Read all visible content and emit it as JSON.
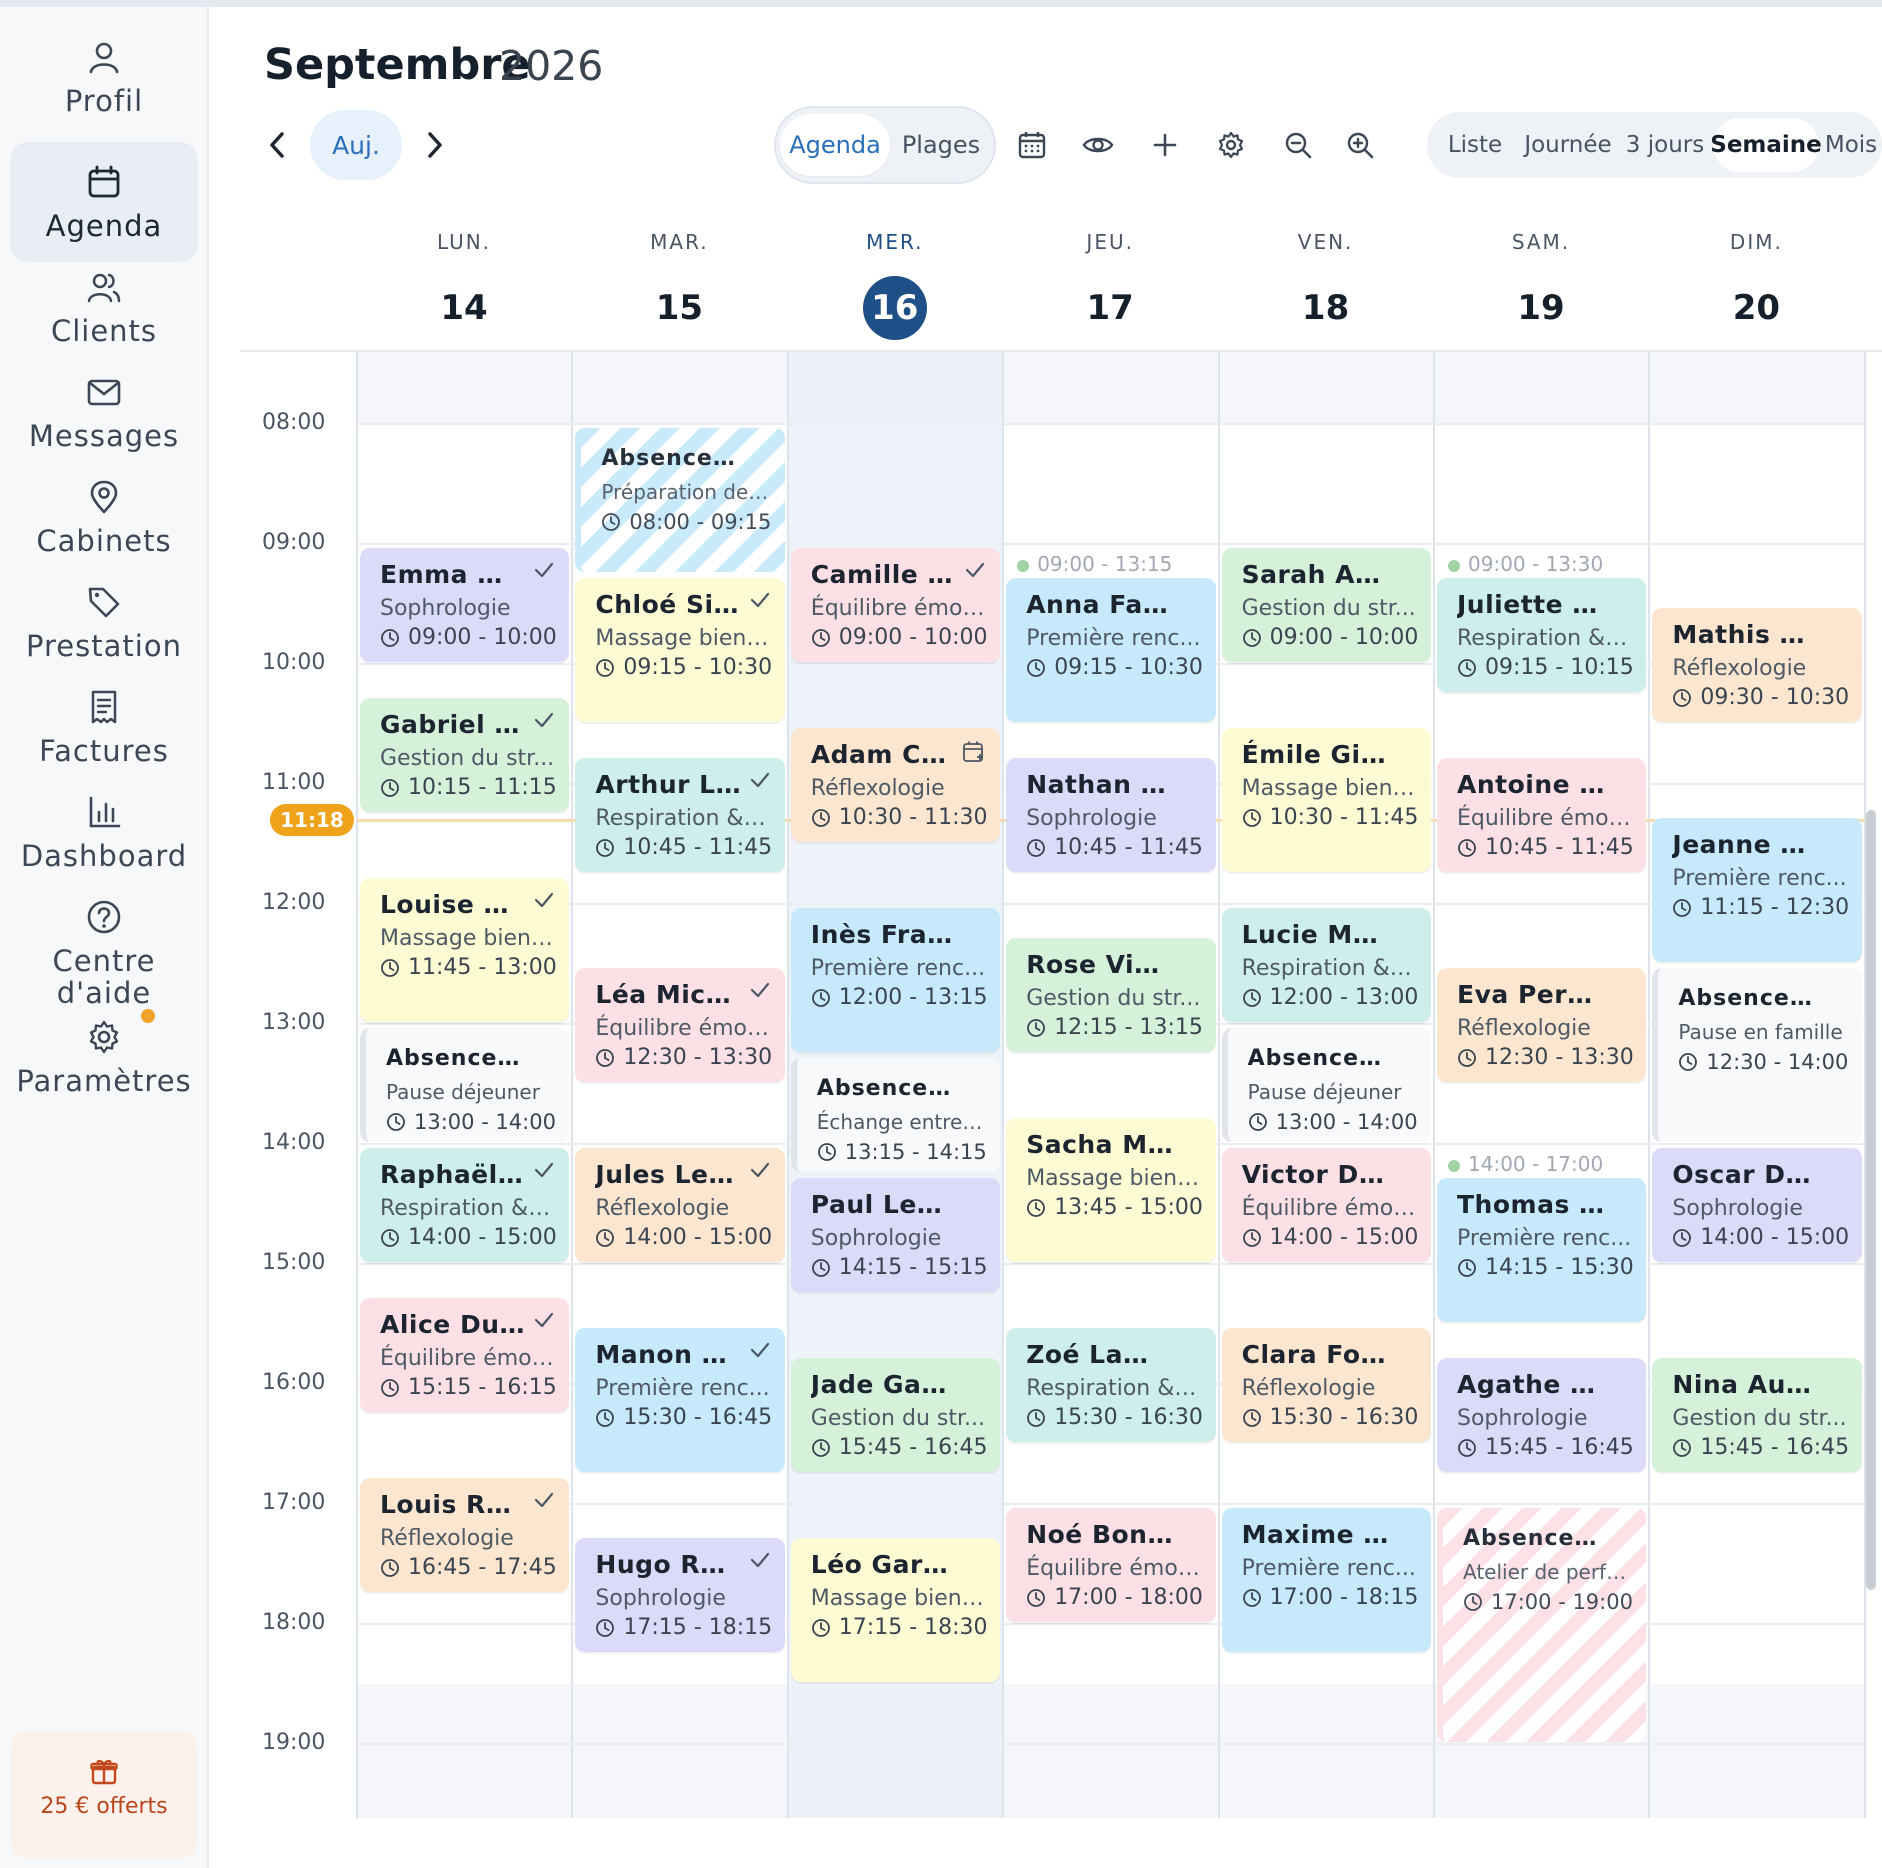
{
  "sidebar": {
    "items": [
      {
        "label": "Profil",
        "icon": "user-icon"
      },
      {
        "label": "Agenda",
        "icon": "calendar-icon",
        "active": true
      },
      {
        "label": "Clients",
        "icon": "users-icon"
      },
      {
        "label": "Messages",
        "icon": "mail-icon"
      },
      {
        "label": "Cabinets",
        "icon": "map-pin-icon"
      },
      {
        "label": "Prestation",
        "icon": "tag-icon"
      },
      {
        "label": "Factures",
        "icon": "receipt-icon"
      },
      {
        "label": "Dashboard",
        "icon": "bar-chart-icon"
      },
      {
        "label": "Centre d'aide",
        "icon": "help-circle-icon"
      },
      {
        "label": "Paramètres",
        "icon": "gear-icon",
        "notification": true
      }
    ],
    "promo": {
      "label": "25 € offerts",
      "icon": "gift-icon"
    }
  },
  "header": {
    "month": "Septembre",
    "year": "2026",
    "today_label": "Auj.",
    "modes": [
      "Agenda",
      "Plages"
    ],
    "active_mode": "Agenda",
    "views": [
      "Liste",
      "Journée",
      "3 jours",
      "Semaine",
      "Mois"
    ],
    "active_view": "Semaine"
  },
  "days": [
    {
      "name": "LUN.",
      "num": "14"
    },
    {
      "name": "MAR.",
      "num": "15"
    },
    {
      "name": "MER.",
      "num": "16",
      "today": true
    },
    {
      "name": "JEU.",
      "num": "17"
    },
    {
      "name": "VEN.",
      "num": "18"
    },
    {
      "name": "SAM.",
      "num": "19"
    },
    {
      "name": "DIM.",
      "num": "20"
    }
  ],
  "hours": [
    "08:00",
    "09:00",
    "10:00",
    "11:00",
    "12:00",
    "13:00",
    "14:00",
    "15:00",
    "16:00",
    "17:00",
    "18:00",
    "19:00"
  ],
  "now": "11:18",
  "colors": {
    "violet": "#dcdaf9",
    "green": "#d5f1d9",
    "yellow": "#fdfbd3",
    "teal": "#cdeeea",
    "pink": "#fde0e6",
    "peach": "#fde6cf",
    "blue": "#c6e9fb",
    "absence": "#f8f9fb",
    "today_column": "#eef3fa",
    "accent": "#1e4f86",
    "now": "#efa21a"
  },
  "slots": [
    {
      "day": 3,
      "range": "09:00 - 13:15"
    },
    {
      "day": 5,
      "range": "09:00 - 13:30"
    },
    {
      "day": 5,
      "range": "14:00 - 17:00"
    }
  ],
  "events": [
    {
      "day": 0,
      "title": "Emma Mo...",
      "sub": "Sophrologie",
      "time": "09:00 - 10:00",
      "color": "violet",
      "check": true
    },
    {
      "day": 0,
      "title": "Gabriel Pe...",
      "sub": "Gestion du str...",
      "time": "10:15 - 11:15",
      "color": "green",
      "check": true
    },
    {
      "day": 0,
      "title": "Louise Ma...",
      "sub": "Massage bien-...",
      "time": "11:45 - 13:00",
      "color": "yellow",
      "check": true
    },
    {
      "day": 0,
      "title": "Absence · Per...",
      "sub": "Pause déjeuner",
      "time": "13:00 - 14:00",
      "color": "absence",
      "absence": true
    },
    {
      "day": 0,
      "title": "Raphaël B...",
      "sub": "Respiration & ...",
      "time": "14:00 - 15:00",
      "color": "teal",
      "check": true
    },
    {
      "day": 0,
      "title": "Alice Dub...",
      "sub": "Équilibre émot...",
      "time": "15:15 - 16:15",
      "color": "pink",
      "check": true
    },
    {
      "day": 0,
      "title": "Louis Rob...",
      "sub": "Réflexologie",
      "time": "16:45 - 17:45",
      "color": "peach",
      "check": true
    },
    {
      "day": 1,
      "title": "Absence · Aut...",
      "sub": "Préparation des ...",
      "time": "08:00 - 09:15",
      "color": "blue",
      "absence": true,
      "striped": true
    },
    {
      "day": 1,
      "title": "Chloé Sim...",
      "sub": "Massage bien-...",
      "time": "09:15 - 10:30",
      "color": "yellow",
      "check": true
    },
    {
      "day": 1,
      "title": "Arthur La...",
      "sub": "Respiration & ...",
      "time": "10:45 - 11:45",
      "color": "teal",
      "check": true
    },
    {
      "day": 1,
      "title": "Léa Michel",
      "sub": "Équilibre émot...",
      "time": "12:30 - 13:30",
      "color": "pink",
      "check": true
    },
    {
      "day": 1,
      "title": "Jules Lefè...",
      "sub": "Réflexologie",
      "time": "14:00 - 15:00",
      "color": "peach",
      "check": true
    },
    {
      "day": 1,
      "title": "Manon Le...",
      "sub": "Première renc...",
      "time": "15:30 - 16:45",
      "color": "blue",
      "check": true
    },
    {
      "day": 1,
      "title": "Hugo Roux",
      "sub": "Sophrologie",
      "time": "17:15 - 18:15",
      "color": "violet",
      "check": true
    },
    {
      "day": 2,
      "title": "Camille F...",
      "sub": "Équilibre émot...",
      "time": "09:00 - 10:00",
      "color": "pink",
      "check": true
    },
    {
      "day": 2,
      "title": "Adam Che...",
      "sub": "Réflexologie",
      "time": "10:30 - 11:30",
      "color": "peach",
      "calendar": true
    },
    {
      "day": 2,
      "title": "Inès François",
      "sub": "Première renc...",
      "time": "12:00 - 13:15",
      "color": "blue"
    },
    {
      "day": 2,
      "title": "Absence · Aut...",
      "sub": "Échange entre p...",
      "time": "13:15 - 14:15",
      "color": "absence",
      "absence": true
    },
    {
      "day": 2,
      "title": "Paul Legrand",
      "sub": "Sophrologie",
      "time": "14:15 - 15:15",
      "color": "violet"
    },
    {
      "day": 2,
      "title": "Jade Gauthier",
      "sub": "Gestion du str...",
      "time": "15:45 - 16:45",
      "color": "green"
    },
    {
      "day": 2,
      "title": "Léo Garnier",
      "sub": "Massage bien-...",
      "time": "17:15 - 18:30",
      "color": "yellow"
    },
    {
      "day": 3,
      "title": "Anna Faure",
      "sub": "Première renc...",
      "time": "09:15 - 10:30",
      "color": "blue"
    },
    {
      "day": 3,
      "title": "Nathan Rous...",
      "sub": "Sophrologie",
      "time": "10:45 - 11:45",
      "color": "violet"
    },
    {
      "day": 3,
      "title": "Rose Vincent",
      "sub": "Gestion du str...",
      "time": "12:15 - 13:15",
      "color": "green"
    },
    {
      "day": 3,
      "title": "Sacha Muller",
      "sub": "Massage bien-...",
      "time": "13:45 - 15:00",
      "color": "yellow"
    },
    {
      "day": 3,
      "title": "Zoé Lambert",
      "sub": "Respiration & ...",
      "time": "15:30 - 16:30",
      "color": "teal"
    },
    {
      "day": 3,
      "title": "Noé Bonnet",
      "sub": "Équilibre émot...",
      "time": "17:00 - 18:00",
      "color": "pink"
    },
    {
      "day": 4,
      "title": "Sarah André",
      "sub": "Gestion du str...",
      "time": "09:00 - 10:00",
      "color": "green"
    },
    {
      "day": 4,
      "title": "Émile Girard",
      "sub": "Massage bien-...",
      "time": "10:30 - 11:45",
      "color": "yellow"
    },
    {
      "day": 4,
      "title": "Lucie Mercier",
      "sub": "Respiration & ...",
      "time": "12:00 - 13:00",
      "color": "teal"
    },
    {
      "day": 4,
      "title": "Absence · Per...",
      "sub": "Pause déjeuner",
      "time": "13:00 - 14:00",
      "color": "absence",
      "absence": true
    },
    {
      "day": 4,
      "title": "Victor Dupont",
      "sub": "Équilibre émot...",
      "time": "14:00 - 15:00",
      "color": "pink"
    },
    {
      "day": 4,
      "title": "Clara Fournier",
      "sub": "Réflexologie",
      "time": "15:30 - 16:30",
      "color": "peach"
    },
    {
      "day": 4,
      "title": "Maxime Robin",
      "sub": "Première renc...",
      "time": "17:00 - 18:15",
      "color": "blue"
    },
    {
      "day": 5,
      "title": "Juliette Mas...",
      "sub": "Respiration & ...",
      "time": "09:15 - 10:15",
      "color": "teal"
    },
    {
      "day": 5,
      "title": "Antoine Lecl...",
      "sub": "Équilibre émot...",
      "time": "10:45 - 11:45",
      "color": "pink"
    },
    {
      "day": 5,
      "title": "Eva Perrin",
      "sub": "Réflexologie",
      "time": "12:30 - 13:30",
      "color": "peach"
    },
    {
      "day": 5,
      "title": "Thomas Henry",
      "sub": "Première renc...",
      "time": "14:15 - 15:30",
      "color": "blue"
    },
    {
      "day": 5,
      "title": "Agathe Rous...",
      "sub": "Sophrologie",
      "time": "15:45 - 16:45",
      "color": "violet"
    },
    {
      "day": 5,
      "title": "Absence · Aut...",
      "sub": "Atelier de perfec...",
      "time": "17:00 - 19:00",
      "color": "pink",
      "absence": true,
      "striped": true
    },
    {
      "day": 6,
      "title": "Mathis Nicol...",
      "sub": "Réflexologie",
      "time": "09:30 - 10:30",
      "color": "peach"
    },
    {
      "day": 6,
      "title": "Jeanne Caron",
      "sub": "Première renc...",
      "time": "11:15 - 12:30",
      "color": "blue"
    },
    {
      "day": 6,
      "title": "Absence · Per...",
      "sub": "Pause en famille",
      "time": "12:30 - 14:00",
      "color": "absence",
      "absence": true
    },
    {
      "day": 6,
      "title": "Oscar Denis",
      "sub": "Sophrologie",
      "time": "14:00 - 15:00",
      "color": "violet"
    },
    {
      "day": 6,
      "title": "Nina Aubert",
      "sub": "Gestion du str...",
      "time": "15:45 - 16:45",
      "color": "green"
    }
  ]
}
